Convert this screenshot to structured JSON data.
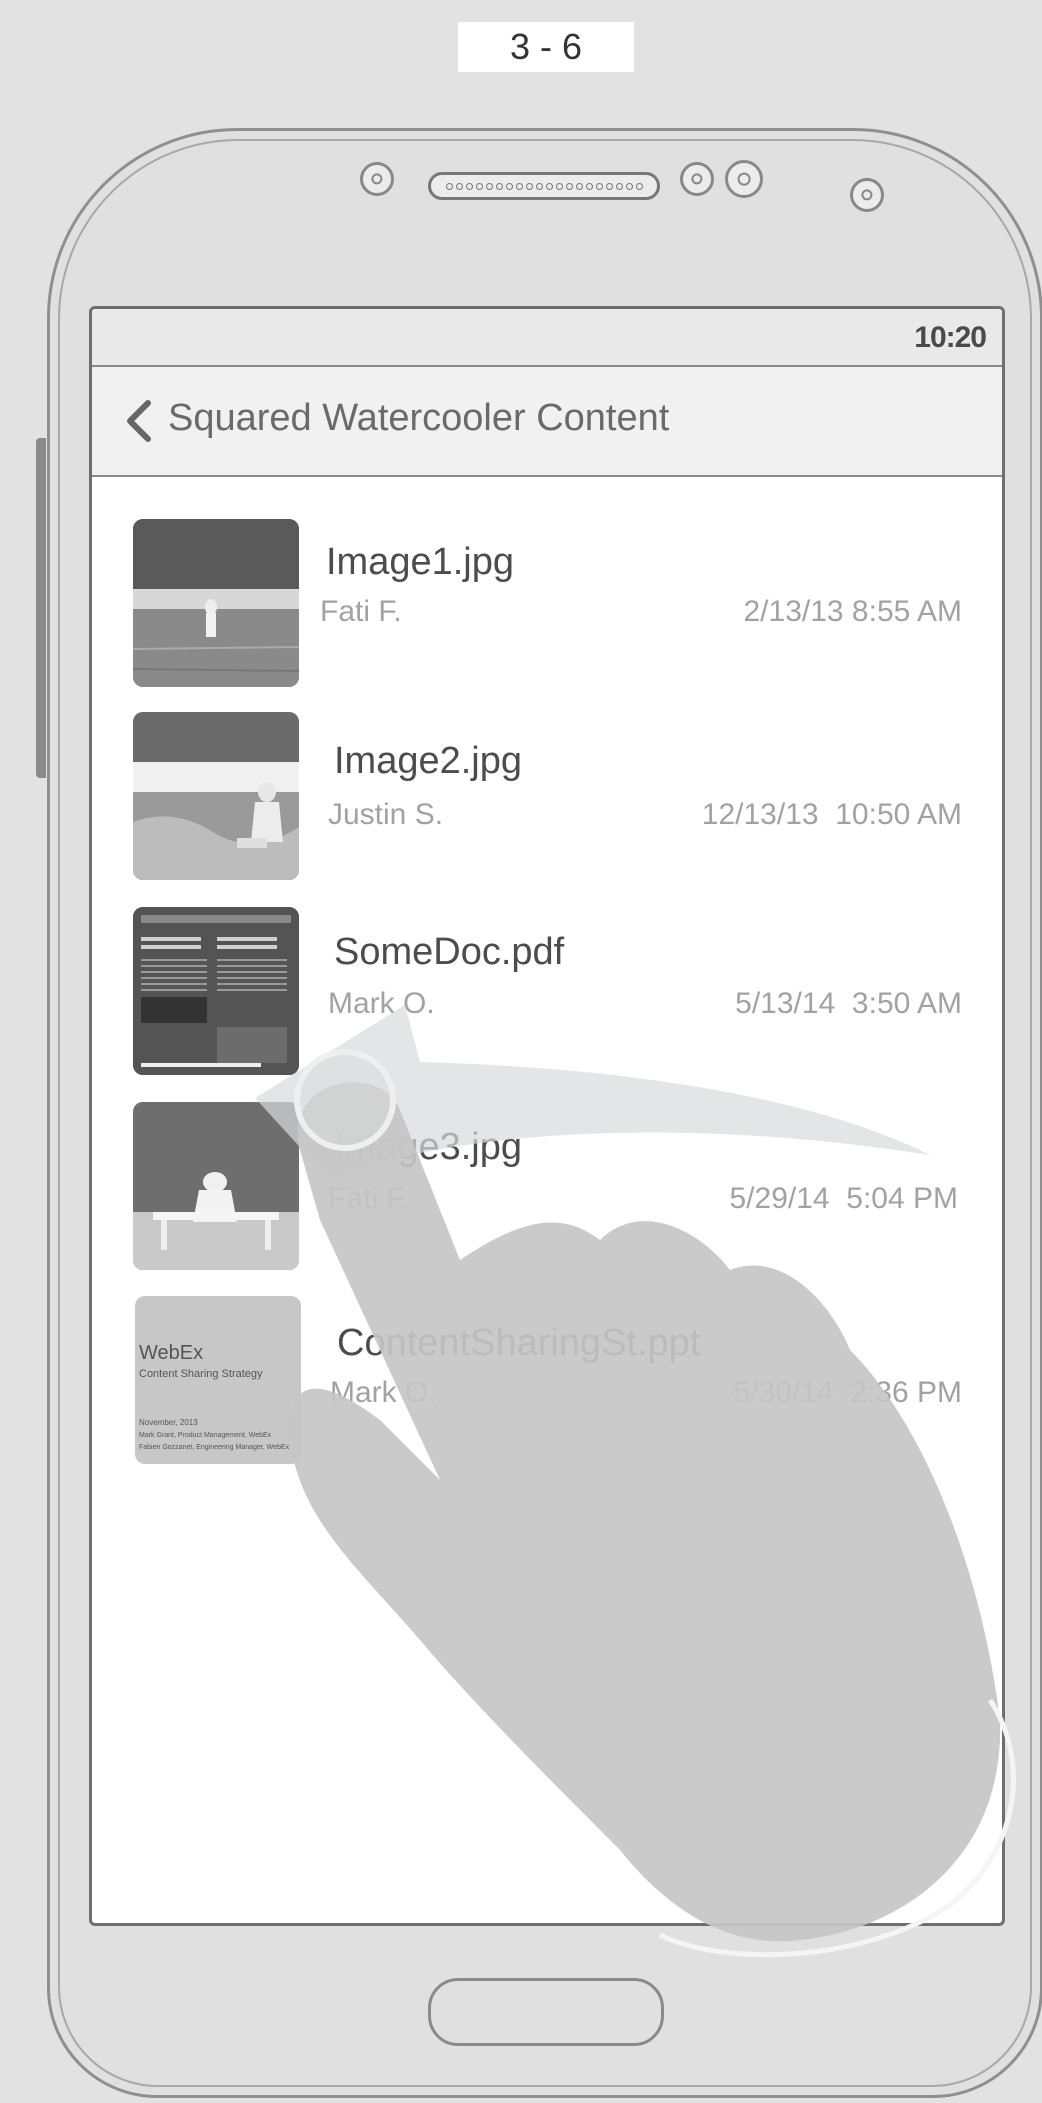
{
  "step_label": "3 - 6",
  "status_bar": {
    "time": "10:20"
  },
  "app_bar": {
    "back_icon": "chevron-left-icon",
    "title": "Squared Watercooler Content"
  },
  "files": [
    {
      "name": "Image1.jpg",
      "author": "Fati F.",
      "date": "2/13/13 8:55 AM",
      "thumb": "photo-person-field"
    },
    {
      "name": "Image2.jpg",
      "author": "Justin S.",
      "date": "12/13/13  10:50 AM",
      "thumb": "photo-person-lake"
    },
    {
      "name": "SomeDoc.pdf",
      "author": "Mark O.",
      "date": "5/13/14  3:50 AM",
      "thumb": "document-preview"
    },
    {
      "name": "Image3.jpg",
      "author": "Fati F.",
      "date": "5/29/14  5:04 PM",
      "thumb": "photo-person-bench"
    },
    {
      "name": "ContentSharingSt.ppt",
      "author": "Mark O.",
      "date": "5/30/14  2:36 PM",
      "thumb": "slide-preview"
    }
  ],
  "slide_thumb": {
    "brand": "WebEx",
    "subtitle": "Content Sharing Strategy",
    "date": "November, 2013",
    "line1": "Mark Grant, Product Management, WebEx",
    "line2": "Fabien Gozzanet, Engineering Manager, WebEx"
  },
  "gesture": {
    "hand_icon": "swipe-left-hand-icon",
    "arrow_icon": "swipe-arrow-left-icon"
  }
}
